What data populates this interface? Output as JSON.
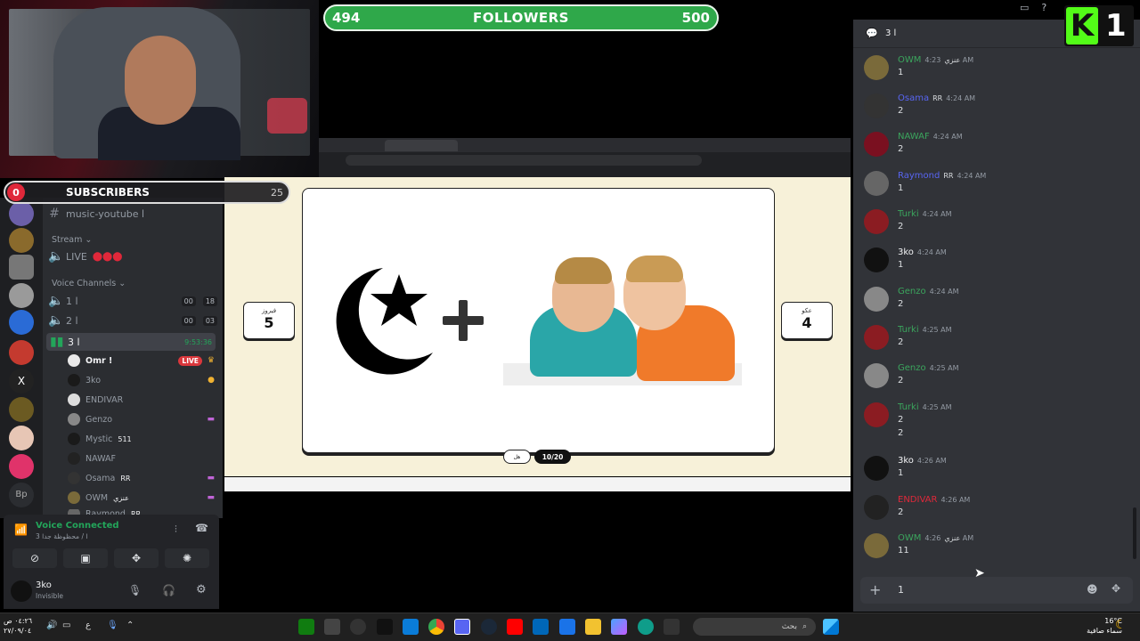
{
  "stream": {
    "followers": {
      "current": "494",
      "label": "FOLLOWERS",
      "goal": "500"
    },
    "subscribers": {
      "current": "0",
      "label": "SUBSCRIBERS",
      "goal": "25"
    },
    "kick_logo": "K",
    "kick_count": "1"
  },
  "discord": {
    "channels": [
      {
        "label": "music-youtube ا"
      }
    ],
    "category_stream": "Stream",
    "live_channel": "LIVE",
    "category_voice": "Voice Channels",
    "voice_channels": [
      {
        "label": "1 ا",
        "c1": "00",
        "c2": "18"
      },
      {
        "label": "2 ا",
        "c1": "00",
        "c2": "03"
      },
      {
        "label": "3 ا",
        "timer": "9:53:36"
      }
    ],
    "voice_users": [
      {
        "name": "Omr !",
        "badge": "LIVE"
      },
      {
        "name": "3ko"
      },
      {
        "name": "ENDIVAR"
      },
      {
        "name": "Genzo"
      },
      {
        "name": "Mystic",
        "extra": "511"
      },
      {
        "name": "NAWAF"
      },
      {
        "name": "Osama",
        "extra": "RR"
      },
      {
        "name": "OWM",
        "extra": "عنزي"
      },
      {
        "name": "Raymond",
        "extra": "RR"
      }
    ],
    "voice_connected": "Voice Connected",
    "voice_sub": "3 ا / محظوظة جدا",
    "user_name": "3ko",
    "user_status": "Invisible"
  },
  "game": {
    "team_left_name": "فيروز",
    "team_left_score": "5",
    "team_right_name": "عكو",
    "team_right_score": "4",
    "counter": "10/20",
    "hint": "هل"
  },
  "chat": {
    "channel_title": "3 ا",
    "messages": [
      {
        "name": "OWM",
        "tag": "عنزي",
        "time": "4:23 AM",
        "text": "1",
        "color": "#3ba55d"
      },
      {
        "name": "Osama",
        "tag": "RR",
        "time": "4:24 AM",
        "text": "2",
        "color": "#5865f2"
      },
      {
        "name": "NAWAF",
        "tag": "",
        "time": "4:24 AM",
        "text": "2",
        "color": "#3ba55d"
      },
      {
        "name": "Raymond",
        "tag": "RR",
        "time": "4:24 AM",
        "text": "1",
        "color": "#5865f2"
      },
      {
        "name": "Turki",
        "tag": "",
        "time": "4:24 AM",
        "text": "2",
        "color": "#3ba55d"
      },
      {
        "name": "3ko",
        "tag": "",
        "time": "4:24 AM",
        "text": "1",
        "color": "#f2f3f5"
      },
      {
        "name": "Genzo",
        "tag": "",
        "time": "4:24 AM",
        "text": "2",
        "color": "#3ba55d"
      },
      {
        "name": "Turki",
        "tag": "",
        "time": "4:25 AM",
        "text": "2",
        "color": "#3ba55d"
      },
      {
        "name": "Genzo",
        "tag": "",
        "time": "4:25 AM",
        "text": "2",
        "color": "#3ba55d"
      },
      {
        "name": "Turki",
        "tag": "",
        "time": "4:25 AM",
        "text": "2",
        "text2": "2",
        "color": "#3ba55d"
      },
      {
        "name": "3ko",
        "tag": "",
        "time": "4:26 AM",
        "text": "1",
        "color": "#f2f3f5"
      },
      {
        "name": "ENDIVAR",
        "tag": "",
        "time": "4:26 AM",
        "text": "2",
        "color": "#e0283a"
      },
      {
        "name": "OWM",
        "tag": "عنزي",
        "time": "4:26 AM",
        "text": "11",
        "color": "#3ba55d"
      }
    ],
    "input_value": "1"
  },
  "taskbar": {
    "clock_time": "٠٤:٢٦ ص",
    "clock_date": "٢٧/٠٩/٠٤",
    "search_placeholder": "بحث",
    "weather_temp": "16°C",
    "weather_desc": "سماء صافية"
  }
}
